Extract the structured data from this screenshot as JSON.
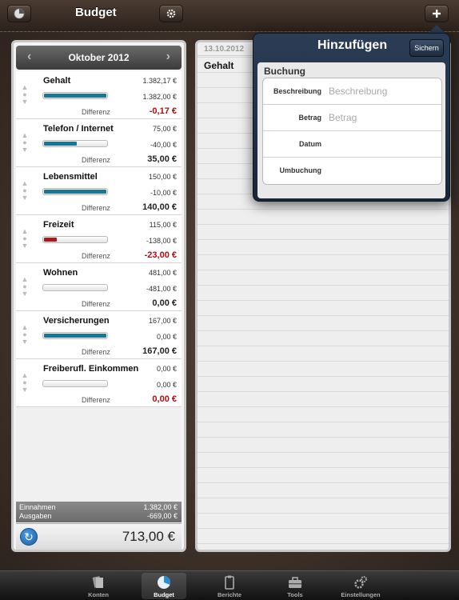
{
  "header": {
    "title": "Budget"
  },
  "month": {
    "label": "Oktober 2012"
  },
  "categories": [
    {
      "name": "Gehalt",
      "budget": "1.382,17 €",
      "spent": "1.382,00 €",
      "diff_label": "Differenz",
      "diff": "-0,17 €",
      "progress": 1.0,
      "bar_color": "#1d7596",
      "diff_color": "red",
      "spent_color": "black"
    },
    {
      "name": "Telefon / Internet",
      "budget": "75,00 €",
      "spent": "-40,00 €",
      "diff_label": "Differenz",
      "diff": "35,00 €",
      "progress": 0.53,
      "bar_color": "#1d7596",
      "diff_color": "black",
      "spent_color": "red"
    },
    {
      "name": "Lebensmittel",
      "budget": "150,00 €",
      "spent": "-10,00 €",
      "diff_label": "Differenz",
      "diff": "140,00 €",
      "progress": 1.0,
      "bar_color": "#1d7596",
      "diff_color": "black",
      "spent_color": "red"
    },
    {
      "name": "Freizeit",
      "budget": "115,00 €",
      "spent": "-138,00 €",
      "diff_label": "Differenz",
      "diff": "-23,00 €",
      "progress": 0.2,
      "bar_color": "#b1161a",
      "diff_color": "red",
      "spent_color": "red"
    },
    {
      "name": "Wohnen",
      "budget": "481,00 €",
      "spent": "-481,00 €",
      "diff_label": "Differenz",
      "diff": "0,00 €",
      "progress": 0.0,
      "bar_color": "#1d7596",
      "diff_color": "black",
      "spent_color": "red"
    },
    {
      "name": "Versicherungen",
      "budget": "167,00 €",
      "spent": "0,00 €",
      "diff_label": "Differenz",
      "diff": "167,00 €",
      "progress": 1.0,
      "bar_color": "#1d7596",
      "diff_color": "black",
      "spent_color": "black"
    },
    {
      "name": "Freiberufl. Einkommen",
      "budget": "0,00 €",
      "spent": "0,00 €",
      "diff_label": "Differenz",
      "diff": "0,00 €",
      "progress": 0.0,
      "bar_color": "#1d7596",
      "diff_color": "red",
      "spent_color": "black"
    }
  ],
  "summary": {
    "income_label": "Einnahmen",
    "income_value": "1.382,00 €",
    "expenses_label": "Ausgaben",
    "expenses_value": "-669,00 €",
    "total": "713,00 €"
  },
  "ledger": {
    "date": "13.10.2012",
    "entry": "Gehalt"
  },
  "popover": {
    "title": "Hinzufügen",
    "save_label": "Sichern",
    "section": "Buchung",
    "fields": [
      {
        "label": "Beschreibung",
        "placeholder": "Beschreibung",
        "value": ""
      },
      {
        "label": "Betrag",
        "placeholder": "Betrag",
        "value": ""
      },
      {
        "label": "Datum",
        "placeholder": "",
        "value": ""
      },
      {
        "label": "Umbuchung",
        "placeholder": "",
        "value": ""
      }
    ]
  },
  "tabs": [
    {
      "label": "Konten",
      "icon": "accounts-icon",
      "active": false
    },
    {
      "label": "Budget",
      "icon": "pie-chart-icon",
      "active": true
    },
    {
      "label": "Berichte",
      "icon": "report-icon",
      "active": false
    },
    {
      "label": "Tools",
      "icon": "toolbox-icon",
      "active": false
    },
    {
      "label": "Einstellungen",
      "icon": "gears-icon",
      "active": false
    }
  ],
  "colors": {
    "accent_blue": "#1d7596",
    "negative_red": "#b10d10",
    "popover_navy": "#2b3d55"
  }
}
